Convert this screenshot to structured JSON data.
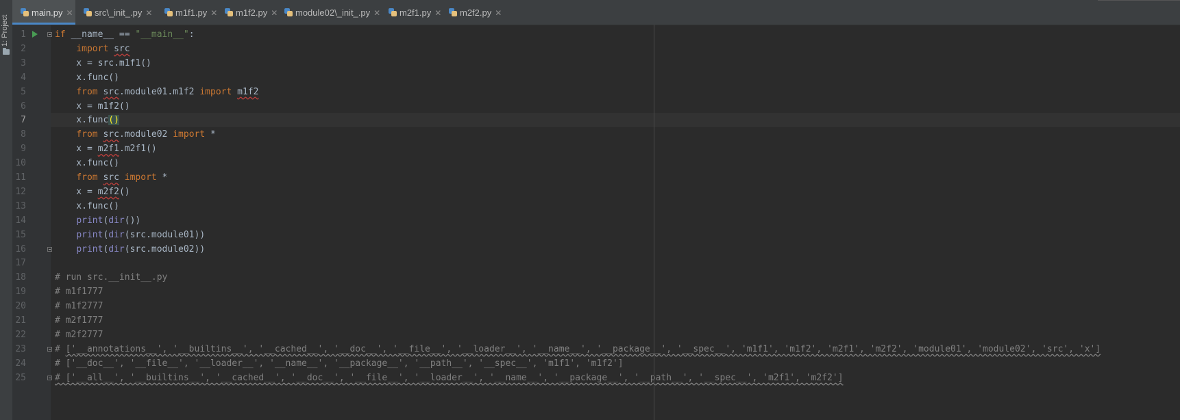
{
  "sidebar": {
    "project_label": "1: Project"
  },
  "tabs": [
    {
      "label": "main.py",
      "active": true
    },
    {
      "label": "src\\_init_.py",
      "active": false
    },
    {
      "label": "m1f1.py",
      "active": false
    },
    {
      "label": "m1f2.py",
      "active": false
    },
    {
      "label": "module02\\_init_.py",
      "active": false
    },
    {
      "label": "m2f1.py",
      "active": false
    },
    {
      "label": "m2f2.py",
      "active": false
    }
  ],
  "editor": {
    "current_line": 7,
    "line_numbers": [
      "1",
      "2",
      "3",
      "4",
      "5",
      "6",
      "7",
      "8",
      "9",
      "10",
      "11",
      "12",
      "13",
      "14",
      "15",
      "16",
      "17",
      "18",
      "19",
      "20",
      "21",
      "22",
      "23",
      "24",
      "25"
    ],
    "lines": [
      [
        [
          "kw",
          "if"
        ],
        [
          "p",
          " __name__ == "
        ],
        [
          "str",
          "\"__main__\""
        ],
        [
          "p",
          ":"
        ]
      ],
      [
        [
          "p",
          "    "
        ],
        [
          "kw",
          "import"
        ],
        [
          "p",
          " "
        ],
        [
          "wv",
          "src"
        ]
      ],
      [
        [
          "p",
          "    x = src.m1f1()"
        ]
      ],
      [
        [
          "p",
          "    x.func()"
        ]
      ],
      [
        [
          "p",
          "    "
        ],
        [
          "kw",
          "from"
        ],
        [
          "p",
          " "
        ],
        [
          "wv",
          "src"
        ],
        [
          "p",
          ".module01.m1f2 "
        ],
        [
          "kw",
          "import"
        ],
        [
          "p",
          " "
        ],
        [
          "wv",
          "m1f2"
        ]
      ],
      [
        [
          "p",
          "    x = m1f2()"
        ]
      ],
      [
        [
          "p",
          "    x.func"
        ],
        [
          "br",
          "()"
        ]
      ],
      [
        [
          "p",
          "    "
        ],
        [
          "kw",
          "from"
        ],
        [
          "p",
          " "
        ],
        [
          "wv",
          "src"
        ],
        [
          "p",
          ".module02 "
        ],
        [
          "kw",
          "import"
        ],
        [
          "p",
          " *"
        ]
      ],
      [
        [
          "p",
          "    x = "
        ],
        [
          "wv",
          "m2f1"
        ],
        [
          "p",
          ".m2f1()"
        ]
      ],
      [
        [
          "p",
          "    x.func()"
        ]
      ],
      [
        [
          "p",
          "    "
        ],
        [
          "kw",
          "from"
        ],
        [
          "p",
          " "
        ],
        [
          "wv",
          "src"
        ],
        [
          "p",
          " "
        ],
        [
          "kw",
          "import"
        ],
        [
          "p",
          " *"
        ]
      ],
      [
        [
          "p",
          "    x = "
        ],
        [
          "wv",
          "m2f2"
        ],
        [
          "p",
          "()"
        ]
      ],
      [
        [
          "p",
          "    x.func()"
        ]
      ],
      [
        [
          "p",
          "    "
        ],
        [
          "bi",
          "print"
        ],
        [
          "p",
          "("
        ],
        [
          "bi",
          "dir"
        ],
        [
          "p",
          "())"
        ]
      ],
      [
        [
          "p",
          "    "
        ],
        [
          "bi",
          "print"
        ],
        [
          "p",
          "("
        ],
        [
          "bi",
          "dir"
        ],
        [
          "p",
          "(src.module01))"
        ]
      ],
      [
        [
          "p",
          "    "
        ],
        [
          "bi",
          "print"
        ],
        [
          "p",
          "("
        ],
        [
          "bi",
          "dir"
        ],
        [
          "p",
          "(src.module02))"
        ]
      ],
      [],
      [
        [
          "cm",
          "# run src.__init__.py"
        ]
      ],
      [
        [
          "cm",
          "# m1f1777"
        ]
      ],
      [
        [
          "cm",
          "# m1f2777"
        ]
      ],
      [
        [
          "cm",
          "# m2f1777"
        ]
      ],
      [
        [
          "cm",
          "# m2f2777"
        ]
      ],
      [
        [
          "cm",
          "# "
        ],
        [
          "cw",
          "['__annotations__', '__builtins__', '__cached__', '__doc__', '__file__', '__loader__', '__name__', '__package__', '__spec__', 'm1f1', 'm1f2', 'm2f1', 'm2f2', 'module01', 'module02', 'src', 'x']"
        ]
      ],
      [
        [
          "cm",
          "# ['__doc__', '__file__', '__loader__', '__name__', '__package__', '__path__', '__spec__', 'm1f1', 'm1f2']"
        ]
      ],
      [
        [
          "cw",
          "# ['__all__', '__builtins__', '__cached__', '__doc__', '__file__', '__loader__', '__name__', '__package__', '__path__', '__spec__', 'm2f1', 'm2f2']"
        ]
      ]
    ]
  },
  "icons": {
    "run": "run-triangle-icon",
    "fold": "fold-marker-icon",
    "tab_file": "python-file-icon",
    "close": "close-icon"
  },
  "colors": {
    "background": "#2b2b2b",
    "keyword": "#cc7832",
    "string": "#6a8759",
    "builtin": "#8888c6",
    "comment": "#808080",
    "error_underline": "#bc3f3c",
    "run_icon": "#499c54"
  }
}
